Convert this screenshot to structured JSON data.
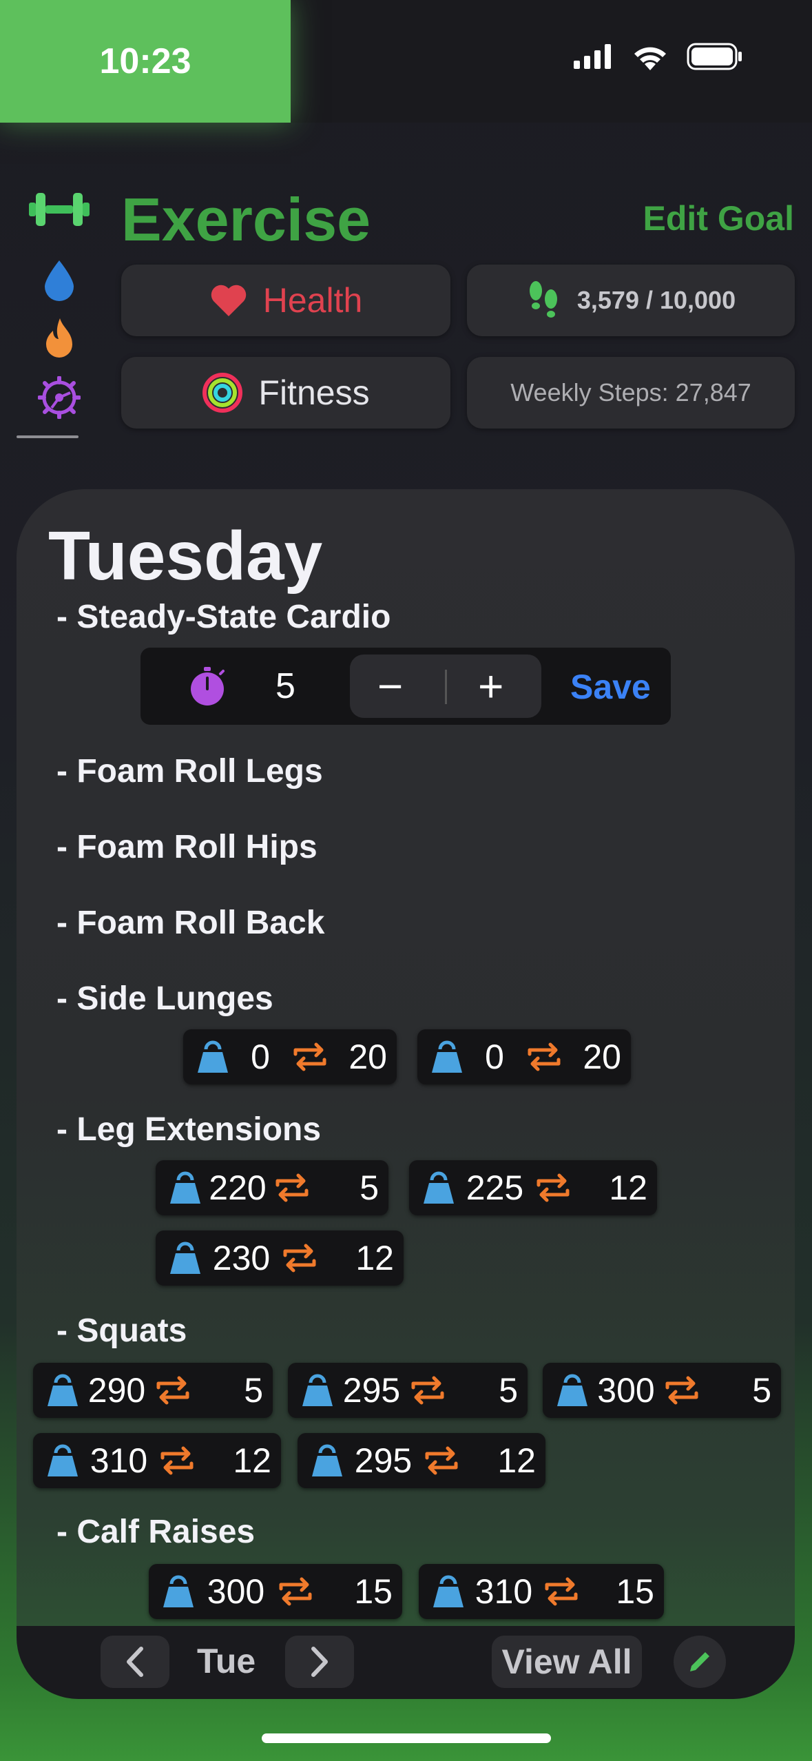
{
  "status_bar": {
    "time": "10:23"
  },
  "header": {
    "title": "Exercise",
    "edit_goal_label": "Edit Goal"
  },
  "side_rail": {
    "items": [
      {
        "icon": "dumbbell-icon"
      },
      {
        "icon": "water-drop-icon"
      },
      {
        "icon": "flame-icon"
      },
      {
        "icon": "gear-icon",
        "selected": true
      }
    ]
  },
  "pills": {
    "health_label": "Health",
    "steps_label": "3,579 / 10,000",
    "fitness_label": "Fitness",
    "weekly_steps_label": "Weekly Steps: 27,847"
  },
  "card": {
    "day": "Tuesday",
    "exercises": [
      {
        "name": "- Steady-State Cardio"
      },
      {
        "name": "- Foam Roll Legs"
      },
      {
        "name": "- Foam Roll Hips"
      },
      {
        "name": "- Foam Roll Back"
      },
      {
        "name": "- Side Lunges"
      },
      {
        "name": "- Leg Extensions"
      },
      {
        "name": "- Squats"
      },
      {
        "name": "- Calf Raises"
      }
    ],
    "timer": {
      "value": "5",
      "minus": "−",
      "plus": "+",
      "save_label": "Save"
    },
    "sets": {
      "side_lunges": [
        {
          "w": "0",
          "r": "20"
        },
        {
          "w": "0",
          "r": "20"
        }
      ],
      "leg_extensions": [
        {
          "w": "220",
          "r": "5"
        },
        {
          "w": "225",
          "r": "12"
        },
        {
          "w": "230",
          "r": "12"
        }
      ],
      "squats": [
        {
          "w": "290",
          "r": "5"
        },
        {
          "w": "295",
          "r": "5"
        },
        {
          "w": "300",
          "r": "5"
        },
        {
          "w": "310",
          "r": "12"
        },
        {
          "w": "295",
          "r": "12"
        }
      ],
      "calf_raises": [
        {
          "w": "300",
          "r": "15"
        },
        {
          "w": "310",
          "r": "15"
        }
      ]
    }
  },
  "bottom_bar": {
    "day_label": "Tue",
    "view_all_label": "View All"
  },
  "colors": {
    "accent_green": "#3fa344",
    "health_red": "#e0424f",
    "save_blue": "#3b82f6",
    "weight_blue": "#4aa3e0",
    "reps_orange": "#f07a2c"
  }
}
